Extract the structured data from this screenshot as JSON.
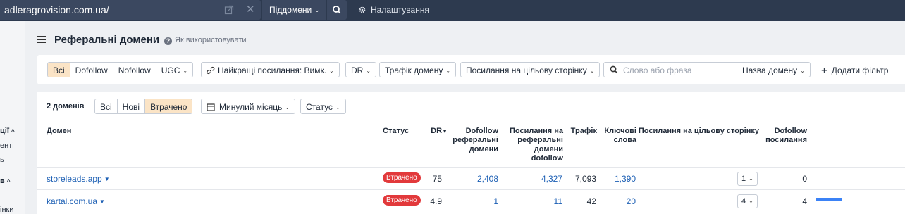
{
  "topbar": {
    "url": "adleragrovision.com.ua/",
    "clear_icon": "close-icon",
    "mode_label": "Піддомени",
    "search_icon": "search-icon",
    "settings_label": "Налаштування"
  },
  "sidebar": {
    "items": [
      "ції",
      "енті",
      "ь",
      "в",
      "інки"
    ]
  },
  "header": {
    "title": "Реферальні домени",
    "help_label": "Як використовувати"
  },
  "filters": {
    "type_options": [
      "Всі",
      "Dofollow",
      "Nofollow",
      "UGC"
    ],
    "type_selected": "Всі",
    "best_links": "Найкращі посилання: Вимк.",
    "dr": "DR",
    "traffic": "Трафік домену",
    "target_links": "Посилання на цільову сторінку",
    "search_placeholder": "Слово або фраза",
    "search_scope": "Назва домену",
    "add_filter": "Додати фільтр"
  },
  "table": {
    "count_label": "2 доменів",
    "state_options": [
      "Всі",
      "Нові",
      "Втрачено"
    ],
    "state_selected": "Втрачено",
    "period": "Минулий місяць",
    "status_filter": "Статус",
    "columns": {
      "domain": "Домен",
      "status": "Статус",
      "dr": "DR",
      "dofollow_ref": [
        "Dofollow",
        "реферальні",
        "домени"
      ],
      "links_ref": [
        "Посилання на",
        "реферальні",
        "домени",
        "dofollow"
      ],
      "traffic": "Трафік",
      "keywords": [
        "Ключові",
        "слова"
      ],
      "target_links": "Посилання на цільову сторінку",
      "dofollow_links": [
        "Dofollow",
        "посилання"
      ]
    },
    "rows": [
      {
        "domain": "storeleads.app",
        "status": "Втрачено",
        "dr": "75",
        "dofollow_ref": "2,408",
        "links_ref": "4,327",
        "traffic": "7,093",
        "keywords": "1,390",
        "target_links": "1",
        "dofollow_links": "0",
        "bar_fraction": 0
      },
      {
        "domain": "kartal.com.ua",
        "status": "Втрачено",
        "dr": "4.9",
        "dofollow_ref": "1",
        "links_ref": "11",
        "traffic": "42",
        "keywords": "20",
        "target_links": "4",
        "dofollow_links": "4",
        "bar_fraction": 1
      }
    ]
  },
  "colors": {
    "topbar": "#2d3a4f",
    "accent": "#fbe4c6",
    "link": "#1c5fb4",
    "lost": "#e2393b",
    "bar": "#3b82f6"
  }
}
